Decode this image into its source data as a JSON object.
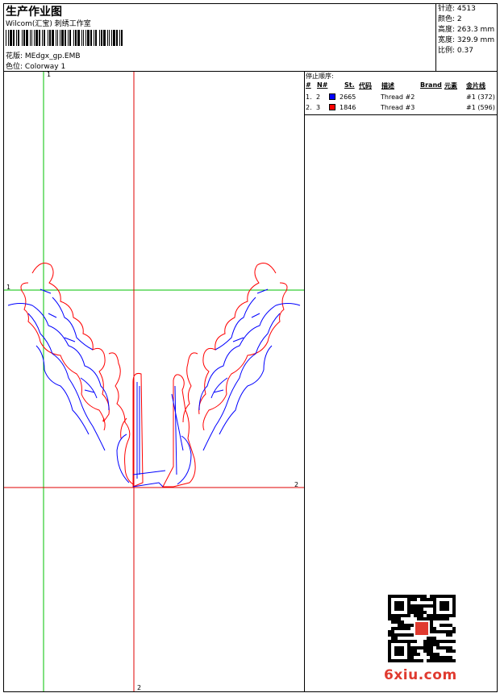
{
  "header": {
    "title": "生产作业图",
    "studio": "Wilcom(汇宝) 刺绣工作室",
    "design_label": "花版:",
    "design_value": "MEdgx_gp.EMB",
    "colorway_label": "色位:",
    "colorway_value": "Colorway 1"
  },
  "stats": [
    {
      "label": "针迹:",
      "value": "4513"
    },
    {
      "label": "颜色:",
      "value": "2"
    },
    {
      "label": "高度:",
      "value": "263.3 mm"
    },
    {
      "label": "宽度:",
      "value": "329.9 mm"
    },
    {
      "label": "比例:",
      "value": "0.37"
    }
  ],
  "stop_sequence": {
    "title": "停止顺序:",
    "columns": {
      "hash": "#",
      "n": "N#",
      "st": "St.",
      "code": "代码",
      "desc": "描述",
      "brand": "Brand",
      "element": "元素",
      "chart": "金片线"
    },
    "rows": [
      {
        "hash": "1.",
        "n": "2",
        "color": "#0000ff",
        "code": "2665",
        "desc": "Thread #2",
        "chart": "#1 (372)"
      },
      {
        "hash": "2.",
        "n": "3",
        "color": "#ff0000",
        "code": "1846",
        "desc": "Thread #3",
        "chart": "#1 (596)"
      }
    ]
  },
  "guides": {
    "h1": "1",
    "v1": "1",
    "h2": "2",
    "v2": "2"
  },
  "colors": {
    "guide_green": "#00c000",
    "guide_red": "#e00000",
    "thread_blue": "#0000ff",
    "thread_red": "#ff0000"
  },
  "watermark": "6xiu.com"
}
